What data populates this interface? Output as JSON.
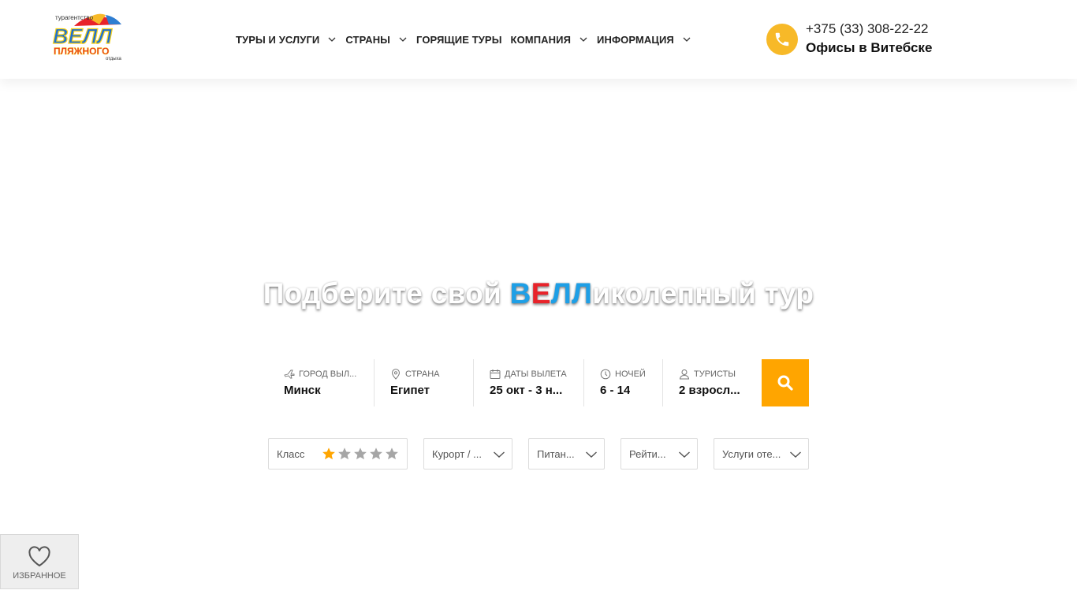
{
  "header": {
    "logo": {
      "alt": "Велл пляжного отдыха",
      "top_text": "турагентство",
      "brand": "ВЕЛЛ",
      "middle_text": "ПЛЯЖНОГО",
      "bottom_text": "отдыха"
    },
    "nav": [
      {
        "label": "ТУРЫ И УСЛУГИ",
        "has_dropdown": true
      },
      {
        "label": "СТРАНЫ",
        "has_dropdown": true
      },
      {
        "label": "ГОРЯЩИЕ ТУРЫ",
        "has_dropdown": false
      },
      {
        "label": "КОМПАНИЯ",
        "has_dropdown": true
      },
      {
        "label": "ИНФОРМАЦИЯ",
        "has_dropdown": true
      }
    ],
    "phone": "+375 (33) 308-22-22",
    "offices": "Офисы в Витебске"
  },
  "hero": {
    "title_before": "Подберите свой ",
    "title_b": "В",
    "title_e": "Е",
    "title_ll": "ЛЛ",
    "title_after": "иколепный тур"
  },
  "search": {
    "fields": [
      {
        "label": "ГОРОД ВЫЛ...",
        "value": "Минск",
        "icon": "plane-icon"
      },
      {
        "label": "СТРАНА",
        "value": "Египет",
        "icon": "location-pin-icon"
      },
      {
        "label": "ДАТЫ ВЫЛЕТА",
        "value": "25 окт - 3 н...",
        "icon": "calendar-icon"
      },
      {
        "label": "НОЧЕЙ",
        "value": "6 - 14",
        "icon": "moon-icon"
      },
      {
        "label": "ТУРИСТЫ",
        "value": "2 взросл...",
        "icon": "person-icon"
      }
    ],
    "button_icon": "search-icon"
  },
  "filters": {
    "class_label": "Класс",
    "stars_total": 5,
    "stars_selected": 1,
    "resort": "Курорт / ...",
    "meal": "Питан...",
    "rating": "Рейти...",
    "services": "Услуги оте..."
  },
  "favorites": {
    "label": "ИЗБРАННОЕ",
    "icon": "heart-icon"
  },
  "colors": {
    "accent": "#ffa500",
    "phone_bg": "#f7b928",
    "brand_blue": "#1e9fe6",
    "brand_red": "#e8232a",
    "star_active": "#ffa500",
    "star_inactive": "#a6a6a6"
  }
}
